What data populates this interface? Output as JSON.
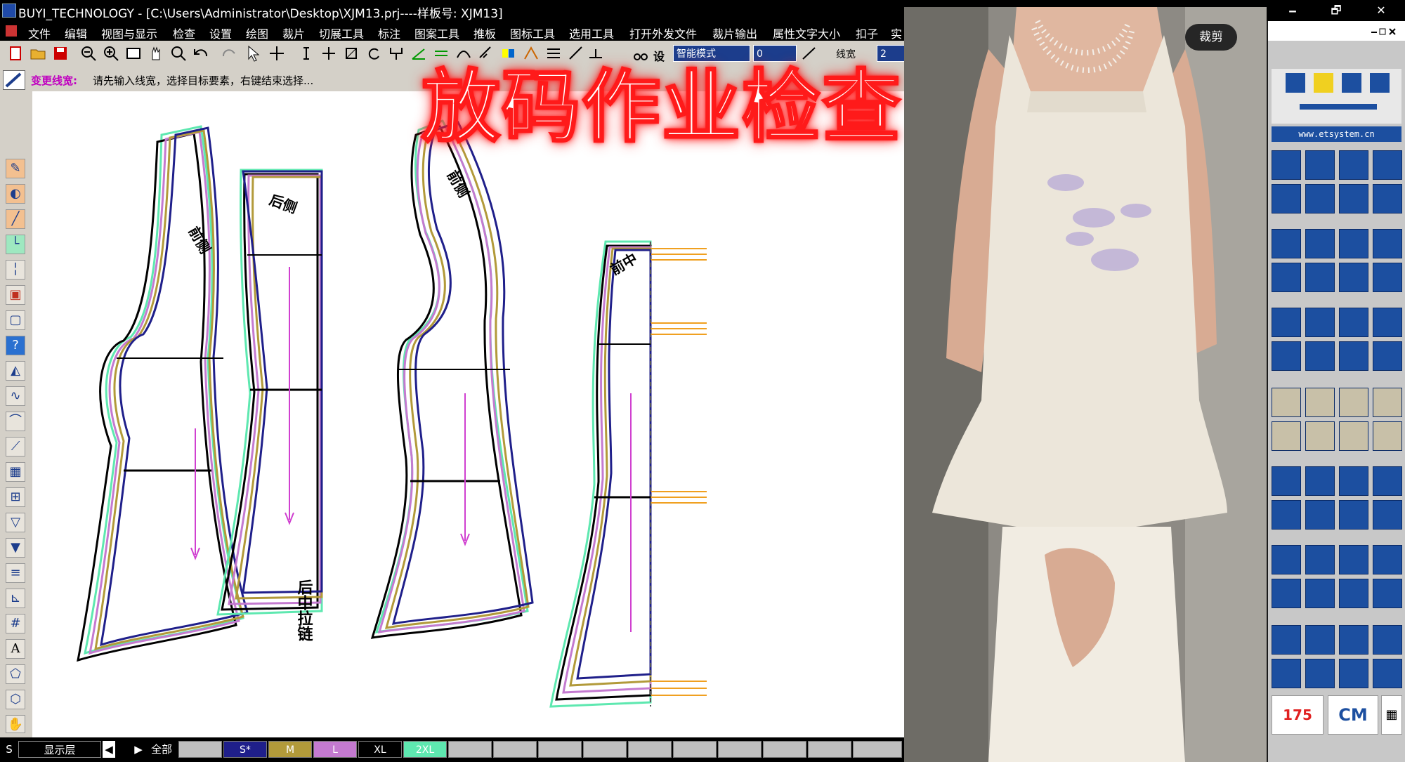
{
  "window": {
    "title": "BUYI_TECHNOLOGY - [C:\\Users\\Administrator\\Desktop\\XJM13.prj----样板号: XJM13]",
    "minimize": "🗕",
    "restore": "🗗",
    "close": "✕"
  },
  "menu": [
    "文件",
    "编辑",
    "视图与显示",
    "检查",
    "设置",
    "绘图",
    "裁片",
    "切展工具",
    "标注",
    "图案工具",
    "推板",
    "图标工具",
    "选用工具",
    "打开外发文件",
    "裁片输出",
    "属性文字大小",
    "扣子",
    "实"
  ],
  "toolbar": {
    "mode_label": "智能模式",
    "value_1": "0",
    "linewidth_label": "线宽",
    "value_2": "2"
  },
  "prompt": {
    "command": "变更线宽:",
    "message": "请先输入线宽，选择目标要素，右键结束选择..."
  },
  "overlay_title": "放码作业检查",
  "pattern_labels": {
    "piece1_top": "前侧",
    "piece2_top": "后侧",
    "piece2_bottom": "后中拉链",
    "piece3_top": "前侧",
    "piece4_top": "前中"
  },
  "photo": {
    "button": "裁剪"
  },
  "right_panel": {
    "url": "www.etsystem.cn",
    "size_value": "175",
    "unit": "CM"
  },
  "status": {
    "s_label": "S",
    "layer_label": "显示层",
    "prev": "◀",
    "next": "▶",
    "all_label": "全部",
    "sizes": [
      {
        "label": "S*",
        "color": "#1f1f8a",
        "text_color": "#ffffff"
      },
      {
        "label": "M",
        "color": "#b29a3a",
        "text_color": "#ffffff"
      },
      {
        "label": "L",
        "color": "#c47ad0",
        "text_color": "#ffffff"
      },
      {
        "label": "XL",
        "color": "#000000",
        "text_color": "#ffffff"
      },
      {
        "label": "2XL",
        "color": "#5ee8b0",
        "text_color": "#ffffff"
      }
    ]
  }
}
